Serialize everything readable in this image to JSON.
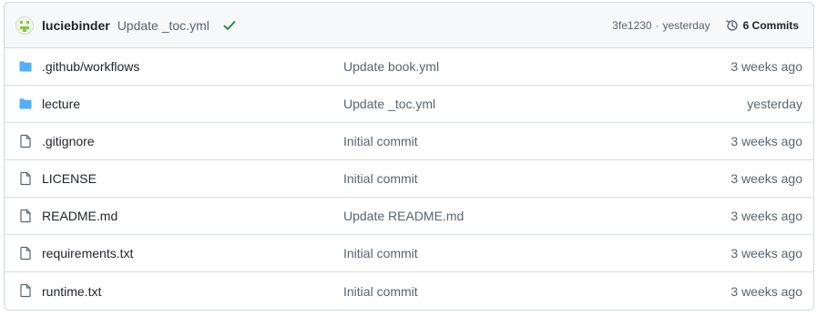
{
  "latest_commit": {
    "author": "luciebinder",
    "message": "Update _toc.yml",
    "sha": "3fe1230",
    "separator": "·",
    "time": "yesterday",
    "commits_label": "6 Commits",
    "status_color": "#1a7f37"
  },
  "files": [
    {
      "type": "folder",
      "icon": "folder-icon",
      "name": ".github/workflows",
      "message": "Update book.yml",
      "time": "3 weeks ago"
    },
    {
      "type": "folder",
      "icon": "folder-icon",
      "name": "lecture",
      "message": "Update _toc.yml",
      "time": "yesterday"
    },
    {
      "type": "file",
      "icon": "file-icon",
      "name": ".gitignore",
      "message": "Initial commit",
      "time": "3 weeks ago"
    },
    {
      "type": "file",
      "icon": "file-icon",
      "name": "LICENSE",
      "message": "Initial commit",
      "time": "3 weeks ago"
    },
    {
      "type": "file",
      "icon": "file-icon",
      "name": "README.md",
      "message": "Update README.md",
      "time": "3 weeks ago"
    },
    {
      "type": "file",
      "icon": "file-icon",
      "name": "requirements.txt",
      "message": "Initial commit",
      "time": "3 weeks ago"
    },
    {
      "type": "file",
      "icon": "file-icon",
      "name": "runtime.txt",
      "message": "Initial commit",
      "time": "3 weeks ago"
    }
  ],
  "colors": {
    "folder": "#54aeff",
    "file": "#59636e",
    "border": "#d0d7de",
    "header_bg": "#f6f8fa"
  }
}
